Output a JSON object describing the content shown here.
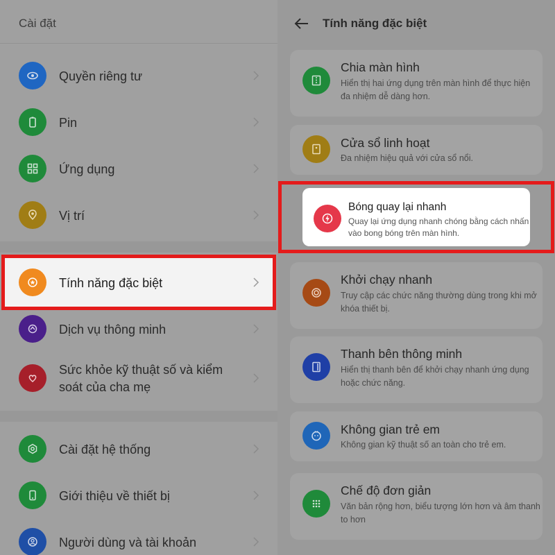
{
  "left": {
    "title": "Cài đặt",
    "items": [
      {
        "label": "Quyền riêng tư",
        "icon": "privacy-eye-icon",
        "color": "#1f66c2"
      },
      {
        "label": "Pin",
        "icon": "battery-icon",
        "color": "#1f8a3a"
      },
      {
        "label": "Ứng dụng",
        "icon": "apps-grid-icon",
        "color": "#1f8a3a"
      },
      {
        "label": "Vị trí",
        "icon": "location-pin-icon",
        "color": "#a07d15"
      },
      {
        "label": "Tính năng đặc biệt",
        "icon": "star-badge-icon",
        "color": "#f08a1f"
      },
      {
        "label": "Dịch vụ thông minh",
        "icon": "smart-service-icon",
        "color": "#4a1f8a"
      },
      {
        "label": "Sức khỏe kỹ thuật số và kiểm",
        "label2": "soát của cha mẹ",
        "icon": "heart-person-icon",
        "color": "#a61f2a"
      },
      {
        "label": "Cài đặt hệ thống",
        "icon": "system-gear-icon",
        "color": "#1f8a3a"
      },
      {
        "label": "Giới thiệu về thiết bị",
        "icon": "phone-device-icon",
        "color": "#1f8a3a"
      },
      {
        "label": "Người dùng và tài khoản",
        "icon": "user-account-icon",
        "color": "#1f4fa6"
      }
    ]
  },
  "right": {
    "title": "Tính năng đặc biệt",
    "cards": [
      {
        "title": "Chia màn hình",
        "desc": "Hiển thị hai ứng dụng trên màn hình để thực hiện đa nhiệm dễ dàng hơn.",
        "icon": "split-screen-icon",
        "color": "#1f8a3a"
      },
      {
        "title": "Cửa sổ linh hoạt",
        "desc": "Đa nhiệm hiệu quả với cửa sổ nổi.",
        "icon": "floating-window-icon",
        "color": "#a07d15"
      },
      {
        "title": "Bóng quay lại nhanh",
        "desc": "Quay lại ứng dụng nhanh chóng bằng cách nhấn vào bong bóng trên màn hình.",
        "icon": "quick-return-bolt-icon",
        "color": "#e5384a"
      },
      {
        "title": "Khởi chạy nhanh",
        "desc": "Truy cập các chức năng thường dùng trong khi mở khóa thiết bị.",
        "icon": "quick-launch-icon",
        "color": "#a64a15"
      },
      {
        "title": "Thanh bên thông minh",
        "desc": "Hiển thị thanh bên để khởi chạy nhanh ứng dụng hoặc chức năng.",
        "icon": "smart-sidebar-icon",
        "color": "#1f3fa6"
      },
      {
        "title": "Không gian trẻ em",
        "desc": "Không gian kỹ thuật số an toàn cho trẻ em.",
        "icon": "kids-space-icon",
        "color": "#1f66b8"
      },
      {
        "title": "Chế độ đơn giản",
        "desc": "Văn bản rộng hơn, biểu tượng lớn hơn và âm thanh to hơn",
        "icon": "simple-mode-grid-icon",
        "color": "#1f8a3a"
      }
    ]
  }
}
